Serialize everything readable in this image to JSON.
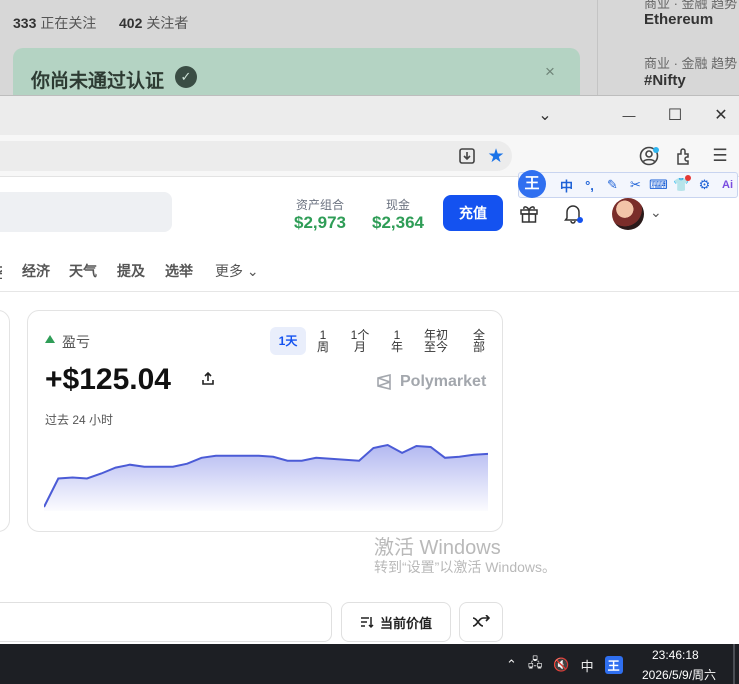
{
  "background_window": {
    "following_count": "333",
    "following_label": "正在关注",
    "followers_count": "402",
    "followers_label": "关注者",
    "banner_title": "你尚未通过认证",
    "banner_close": "×",
    "trends": [
      {
        "meta": "商业 · 金融 趋势",
        "tag": "Ethereum"
      },
      {
        "meta": "商业 · 金融 趋势",
        "tag": "#Nifty"
      }
    ]
  },
  "browser": {
    "window_controls": {
      "chevron": "⌄",
      "minimize": "—",
      "maximize": "☐",
      "close": "✕"
    },
    "ime": {
      "logo": "王",
      "mode": "中",
      "punct": "°,",
      "items": [
        "pen",
        "scissors",
        "keyboard",
        "shirt",
        "gear",
        "ai"
      ]
    }
  },
  "header": {
    "portfolio_label": "资产组合",
    "portfolio_value": "$2,973",
    "cash_label": "现金",
    "cash_value": "$2,364",
    "deposit_label": "充值"
  },
  "categories": [
    "经济",
    "天气",
    "提及",
    "选举",
    "更多"
  ],
  "pnl": {
    "label": "盈亏",
    "value": "+$125.04",
    "period": "过去 24 小时",
    "brand": "Polymarket",
    "ranges": [
      "1天",
      "1周",
      "1个月",
      "1年",
      "年初至今",
      "全部"
    ],
    "active_range": "1天"
  },
  "chart_data": {
    "type": "area",
    "series": [
      {
        "values": [
          118.5,
          121.4,
          121.5,
          121.4,
          121.9,
          122.5,
          122.8,
          122.6,
          122.6,
          122.6,
          122.9,
          123.5,
          123.7,
          123.7,
          123.7,
          123.7,
          123.6,
          123.2,
          123.2,
          123.5,
          123.4,
          123.3,
          123.2,
          124.5,
          124.8,
          124.0,
          124.7,
          124.6,
          123.5,
          123.6,
          123.8,
          123.9
        ]
      }
    ],
    "color": "#4b5bd6"
  },
  "watermark": {
    "title": "激活 Windows",
    "subtitle": "转到“设置”以激活 Windows。"
  },
  "controls": {
    "sort_label": "当前价值"
  },
  "taskbar": {
    "time": "23:46:18",
    "date": "2026/5/9/周六",
    "ime_mode": "中",
    "ime_logo": "王"
  },
  "colors": {
    "accent": "#1452f0",
    "positive": "#2f9d57"
  }
}
